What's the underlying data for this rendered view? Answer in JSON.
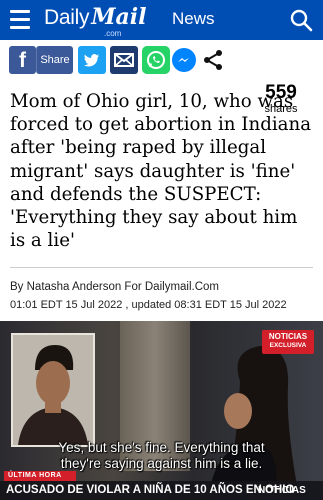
{
  "header": {
    "logo_daily": "Daily",
    "logo_mail": "Mail",
    "logo_com": ".com",
    "section": "News",
    "brand_color": "#004db3"
  },
  "share": {
    "share_label": "Share",
    "count": "559",
    "count_label": "shares",
    "icons": [
      "facebook-icon",
      "twitter-icon",
      "email-icon",
      "whatsapp-icon",
      "messenger-icon",
      "share-icon"
    ]
  },
  "article": {
    "headline": "Mom of Ohio girl, 10, who was forced to get abortion in Indiana after 'being raped by illegal migrant' says daughter is 'fine' and defends the SUSPECT: 'Everything they say about him is a lie'",
    "byline": "By Natasha Anderson For Dailymail.Com",
    "dateline": "01:01 EDT 15 Jul 2022 , updated 08:31 EDT 15 Jul 2022"
  },
  "video": {
    "badge_top": "NOTICIAS",
    "badge_bottom": "EXCLUSIVA",
    "caption_line1": "Yes, but she's fine. Everything that",
    "caption_line2": "they're saying against him is a lie.",
    "ultima_hora": "ÚLTIMA HORA",
    "lower_third": "ACUSADO DE VIOLAR A NIÑA DE 10 AÑOS EN OHIO",
    "lower_brand": "NOTICIAS"
  }
}
